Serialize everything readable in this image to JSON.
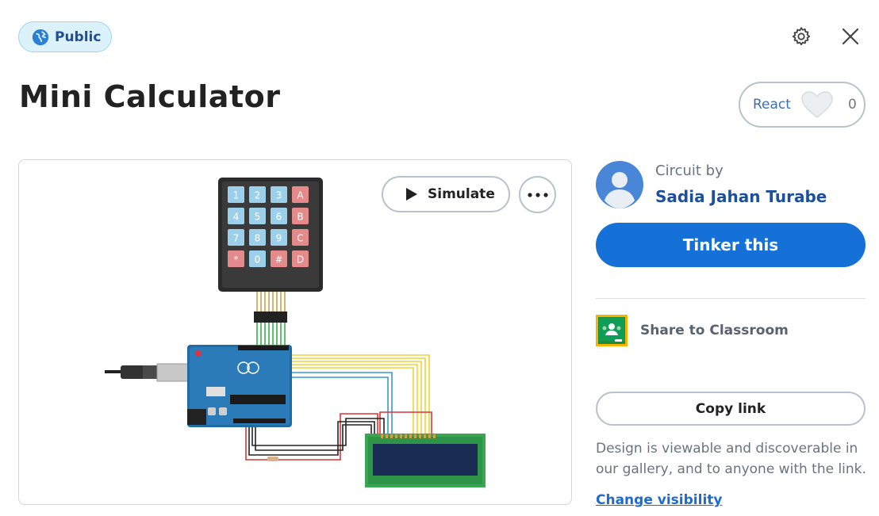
{
  "header": {
    "visibility_badge": "Public",
    "settings_icon": "gear-icon",
    "close_icon": "close-icon"
  },
  "project": {
    "title": "Mini Calculator",
    "react_label": "React",
    "react_count": "0"
  },
  "preview": {
    "simulate_label": "Simulate",
    "more_icon": "more-options-icon",
    "keypad_keys": [
      "1",
      "2",
      "3",
      "A",
      "4",
      "5",
      "6",
      "B",
      "7",
      "8",
      "9",
      "C",
      "*",
      "0",
      "#",
      "D"
    ]
  },
  "author": {
    "circuit_by_label": "Circuit by",
    "name": "Sadia Jahan Turabe"
  },
  "actions": {
    "tinker_label": "Tinker this",
    "share_classroom_label": "Share to Classroom",
    "copy_link_label": "Copy link",
    "description": "Design is viewable and discoverable in our gallery, and to anyone with the link.",
    "change_visibility_label": "Change visibility"
  },
  "colors": {
    "accent_blue": "#1571d8",
    "link_blue": "#1d4f9c",
    "badge_bg": "#dcf2fb"
  }
}
